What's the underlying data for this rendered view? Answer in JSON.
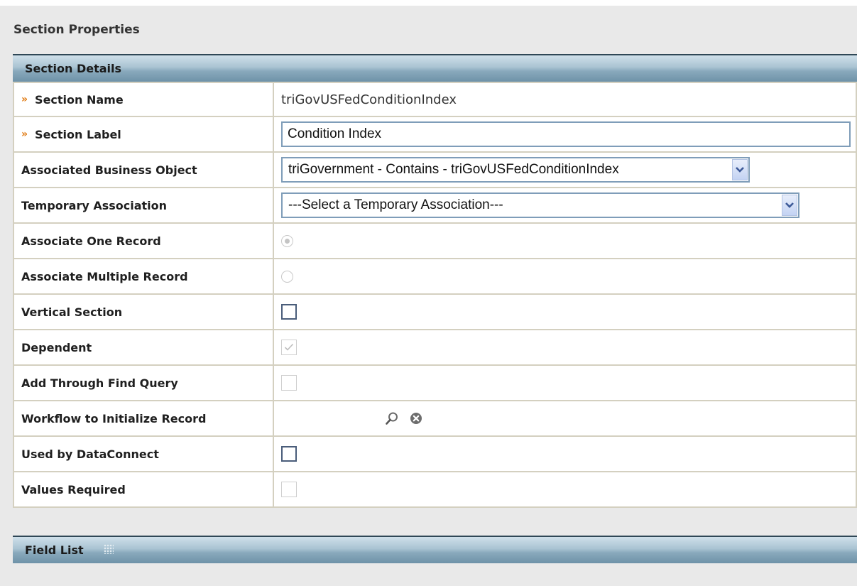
{
  "page": {
    "title": "Section Properties"
  },
  "section_details": {
    "title": "Section Details"
  },
  "field_list": {
    "title": "Field List"
  },
  "rows": {
    "section_name": {
      "label": "Section Name",
      "value": "triGovUSFedConditionIndex",
      "required": true
    },
    "section_label": {
      "label": "Section Label",
      "value": "Condition Index",
      "required": true
    },
    "associated_bo": {
      "label": "Associated Business Object",
      "selected": "triGovernment - Contains - triGovUSFedConditionIndex"
    },
    "temporary_association": {
      "label": "Temporary Association",
      "selected": "---Select a Temporary Association---"
    },
    "associate_one": {
      "label": "Associate One Record",
      "checked": true,
      "disabled": true
    },
    "associate_multiple": {
      "label": "Associate Multiple Record",
      "checked": false,
      "disabled": true
    },
    "vertical_section": {
      "label": "Vertical Section",
      "checked": false,
      "disabled": false
    },
    "dependent": {
      "label": "Dependent",
      "checked": true,
      "disabled": true
    },
    "add_through_find": {
      "label": "Add Through Find Query",
      "checked": false,
      "disabled": true
    },
    "workflow_init": {
      "label": "Workflow to Initialize Record",
      "icons": [
        "search-icon",
        "clear-icon"
      ]
    },
    "used_by_dataconnect": {
      "label": "Used by DataConnect",
      "checked": false,
      "disabled": false
    },
    "values_required": {
      "label": "Values Required",
      "checked": false,
      "disabled": true
    }
  },
  "required_marker": "»",
  "colors": {
    "required": "#e07a12",
    "header_bar": "#89a9bc",
    "input_border": "#7f9db9"
  }
}
